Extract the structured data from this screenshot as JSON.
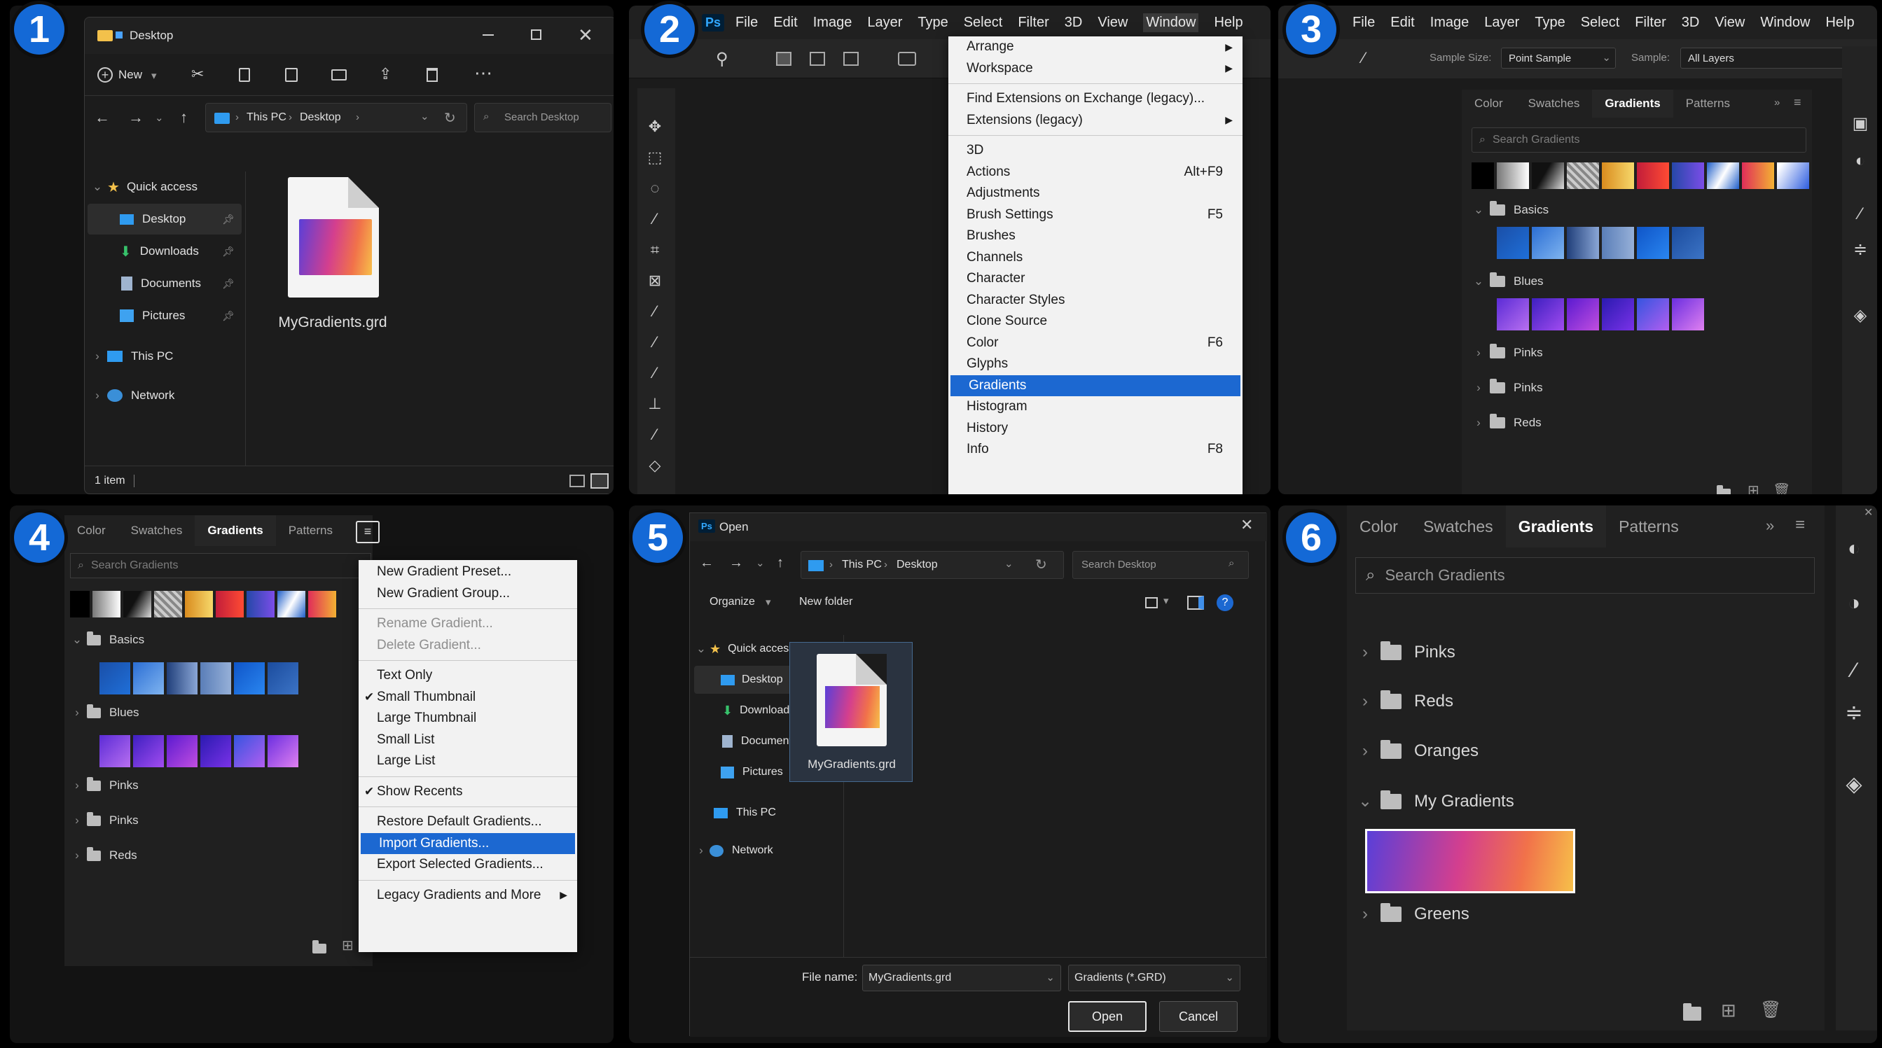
{
  "badges": [
    "1",
    "2",
    "3",
    "4",
    "5",
    "6"
  ],
  "colors": {
    "accent": "#1c68d1",
    "badge": "#1469d6",
    "panel": "#1b1b1b"
  },
  "p1": {
    "title": "Desktop",
    "toolbar_new": "New",
    "breadcrumb": [
      "This PC",
      "Desktop"
    ],
    "search_placeholder": "Search Desktop",
    "tree": {
      "quick_access": "Quick access",
      "items": [
        "Desktop",
        "Downloads",
        "Documents",
        "Pictures"
      ],
      "this_pc": "This PC",
      "network": "Network"
    },
    "file_name": "MyGradients.grd",
    "status": "1 item"
  },
  "p2": {
    "app_icon": "Ps",
    "menu": [
      "File",
      "Edit",
      "Image",
      "Layer",
      "Type",
      "Select",
      "Filter",
      "3D",
      "View",
      "Window",
      "Help"
    ],
    "dropdown": [
      {
        "label": "Arrange",
        "submenu": true
      },
      {
        "label": "Workspace",
        "submenu": true
      },
      {
        "sep": true
      },
      {
        "label": "Find Extensions on Exchange (legacy)..."
      },
      {
        "label": "Extensions (legacy)",
        "submenu": true
      },
      {
        "sep": true
      },
      {
        "label": "3D"
      },
      {
        "label": "Actions",
        "shortcut": "Alt+F9"
      },
      {
        "label": "Adjustments"
      },
      {
        "label": "Brush Settings",
        "shortcut": "F5"
      },
      {
        "label": "Brushes"
      },
      {
        "label": "Channels"
      },
      {
        "label": "Character"
      },
      {
        "label": "Character Styles"
      },
      {
        "label": "Clone Source"
      },
      {
        "label": "Color",
        "shortcut": "F6"
      },
      {
        "label": "Glyphs"
      },
      {
        "label": "Gradients",
        "highlight": true
      },
      {
        "label": "Histogram"
      },
      {
        "label": "History"
      },
      {
        "label": "Info",
        "shortcut": "F8"
      }
    ]
  },
  "p3": {
    "menu": [
      "File",
      "Edit",
      "Image",
      "Layer",
      "Type",
      "Select",
      "Filter",
      "3D",
      "View",
      "Window",
      "Help"
    ],
    "options": {
      "sample_size_label": "Sample Size:",
      "sample_size_value": "Point Sample",
      "sample_label": "Sample:",
      "sample_value": "All Layers"
    },
    "tabs": [
      "Color",
      "Swatches",
      "Gradients",
      "Patterns"
    ],
    "active_tab": "Gradients",
    "search_placeholder": "Search Gradients",
    "groups": [
      "Basics",
      "Blues",
      "Pinks",
      "Pinks",
      "Reds"
    ]
  },
  "p4": {
    "tabs": [
      "Color",
      "Swatches",
      "Gradients",
      "Patterns"
    ],
    "search_placeholder": "Search Gradients",
    "groups": [
      "Basics",
      "Blues",
      "Pinks",
      "Pinks",
      "Reds"
    ],
    "menu": [
      {
        "label": "New Gradient Preset..."
      },
      {
        "label": "New Gradient Group..."
      },
      {
        "sep": true
      },
      {
        "label": "Rename Gradient...",
        "disabled": true
      },
      {
        "label": "Delete Gradient...",
        "disabled": true
      },
      {
        "sep": true
      },
      {
        "label": "Text Only"
      },
      {
        "label": "Small Thumbnail",
        "checked": true
      },
      {
        "label": "Large Thumbnail"
      },
      {
        "label": "Small List"
      },
      {
        "label": "Large List"
      },
      {
        "sep": true
      },
      {
        "label": "Show Recents",
        "checked": true
      },
      {
        "sep": true
      },
      {
        "label": "Restore Default Gradients..."
      },
      {
        "label": "Import Gradients...",
        "highlight": true
      },
      {
        "label": "Export Selected Gradients..."
      },
      {
        "sep": true
      },
      {
        "label": "Legacy Gradients and More",
        "submenu": true
      }
    ]
  },
  "p5": {
    "app_icon": "Ps",
    "title": "Open",
    "breadcrumb": [
      "This PC",
      "Desktop"
    ],
    "search_placeholder": "Search Desktop",
    "organize": "Organize",
    "new_folder": "New folder",
    "tree": {
      "quick_access": "Quick access",
      "items": [
        "Desktop",
        "Downloads",
        "Documents",
        "Pictures"
      ],
      "this_pc": "This PC",
      "network": "Network"
    },
    "file_name_item": "MyGradients.grd",
    "file_name_label": "File name:",
    "file_name_value": "MyGradients.grd",
    "filter_value": "Gradients (*.GRD)",
    "open_button": "Open",
    "cancel_button": "Cancel"
  },
  "p6": {
    "tabs": [
      "Color",
      "Swatches",
      "Gradients",
      "Patterns"
    ],
    "active_tab": "Gradients",
    "search_placeholder": "Search Gradients",
    "groups": [
      {
        "label": "Pinks",
        "expanded": false
      },
      {
        "label": "Reds",
        "expanded": false
      },
      {
        "label": "Oranges",
        "expanded": false
      },
      {
        "label": "My Gradients",
        "expanded": true
      },
      {
        "label": "Greens",
        "expanded": false
      }
    ]
  }
}
